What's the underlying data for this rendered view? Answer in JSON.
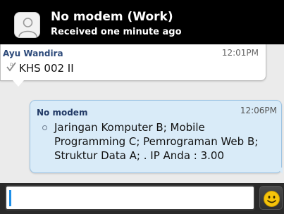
{
  "header": {
    "title": "No modem (Work)",
    "subtitle": "Received one minute ago",
    "avatar_icon": "person-icon"
  },
  "messages": [
    {
      "direction": "incoming",
      "sender": "Ayu Wandira",
      "time": "12:01PM",
      "text": "KHS 002 II",
      "status_icon": "sent-check-icon"
    },
    {
      "direction": "outgoing",
      "sender": "No modem",
      "time": "12:06PM",
      "text": "Jaringan Komputer B; Mobile Programming C; Pemrograman Web B; Struktur Data A; . IP Anda : 3.00",
      "bullet_icon": "bullet-circle-icon"
    }
  ],
  "compose": {
    "value": "",
    "placeholder": "",
    "emoji_icon": "smiley-icon"
  },
  "colors": {
    "header_bg": "#000000",
    "chat_bg": "#ebebeb",
    "outgoing_bubble": "#d9ebf8",
    "cursor": "#1e8fe8",
    "emoji_yellow": "#f6c40a"
  }
}
